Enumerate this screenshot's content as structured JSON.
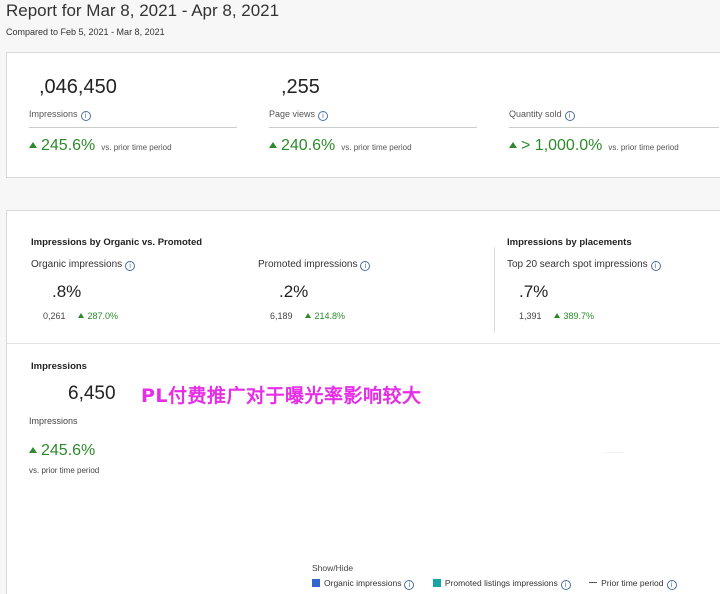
{
  "header": {
    "title": "Report for Mar 8, 2021 - Apr 8, 2021",
    "compared": "Compared to Feb 5, 2021 - Mar 8, 2021"
  },
  "summary": {
    "metrics": [
      {
        "value": ",046,450",
        "label": "Impressions",
        "change": "245.6%",
        "vs": "vs. prior time period"
      },
      {
        "value": ",255",
        "label": "Page views",
        "change": "240.6%",
        "vs": "vs. prior time period"
      },
      {
        "value": "",
        "label": "Quantity sold",
        "change": "> 1,000.0%",
        "vs": "vs. prior time period"
      }
    ]
  },
  "breakdown": {
    "organic_vs_promoted": {
      "heading": "Impressions by Organic vs. Promoted",
      "organic": {
        "label": "Organic impressions",
        "share": ".8%",
        "count": "0,261",
        "change": "287.0%"
      },
      "promoted": {
        "label": "Promoted impressions",
        "share": ".2%",
        "count": "6,189",
        "change": "214.8%"
      }
    },
    "placements": {
      "heading": "Impressions by placements",
      "top20": {
        "label": "Top 20 search spot impressions",
        "share": ".7%",
        "count": "1,391",
        "change": "389.7%"
      }
    }
  },
  "impressions_panel": {
    "heading": "Impressions",
    "value": "6,450",
    "label": "Impressions",
    "change": "245.6%",
    "vs": "vs. prior time period"
  },
  "overlay_text": "PL付费推广对于曝光率影响较大",
  "legend": {
    "title": "Show/Hide",
    "items": [
      {
        "label": "Organic impressions",
        "color": "#3366cc"
      },
      {
        "label": "Promoted listings impressions",
        "color": "#1aa3a3"
      },
      {
        "label": "Prior time period",
        "color": "#555555"
      }
    ]
  },
  "icons": {
    "info": "i",
    "up": "up-arrow-icon"
  }
}
